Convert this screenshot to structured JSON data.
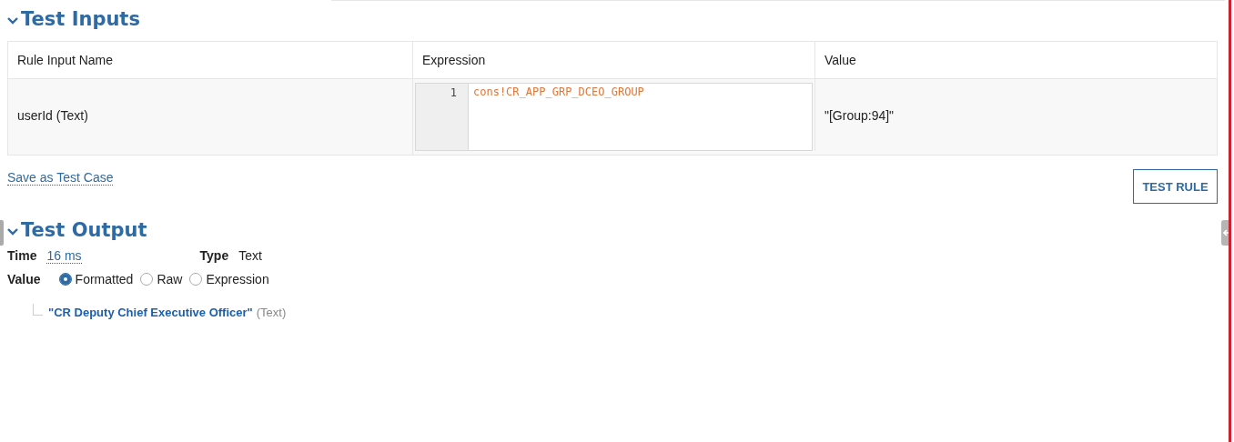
{
  "test_inputs": {
    "title": "Test Inputs",
    "expanded": true,
    "columns": [
      "Rule Input Name",
      "Expression",
      "Value"
    ],
    "rows": [
      {
        "name": "userId (Text)",
        "line_number": "1",
        "expression": "cons!CR_APP_GRP_DCEO_GROUP",
        "value": "\"[Group:94]\""
      }
    ],
    "save_link": "Save as Test Case"
  },
  "test_rule_button": "TEST RULE",
  "test_output": {
    "title": "Test Output",
    "expanded": true,
    "time_label": "Time",
    "time_value": "16 ms",
    "type_label": "Type",
    "type_value": "Text",
    "value_label": "Value",
    "options": [
      {
        "label": "Formatted",
        "selected": true
      },
      {
        "label": "Raw",
        "selected": false
      },
      {
        "label": "Expression",
        "selected": false
      }
    ],
    "result": {
      "value": "\"CR Deputy Chief Executive Officer\"",
      "type": "(Text)"
    }
  }
}
